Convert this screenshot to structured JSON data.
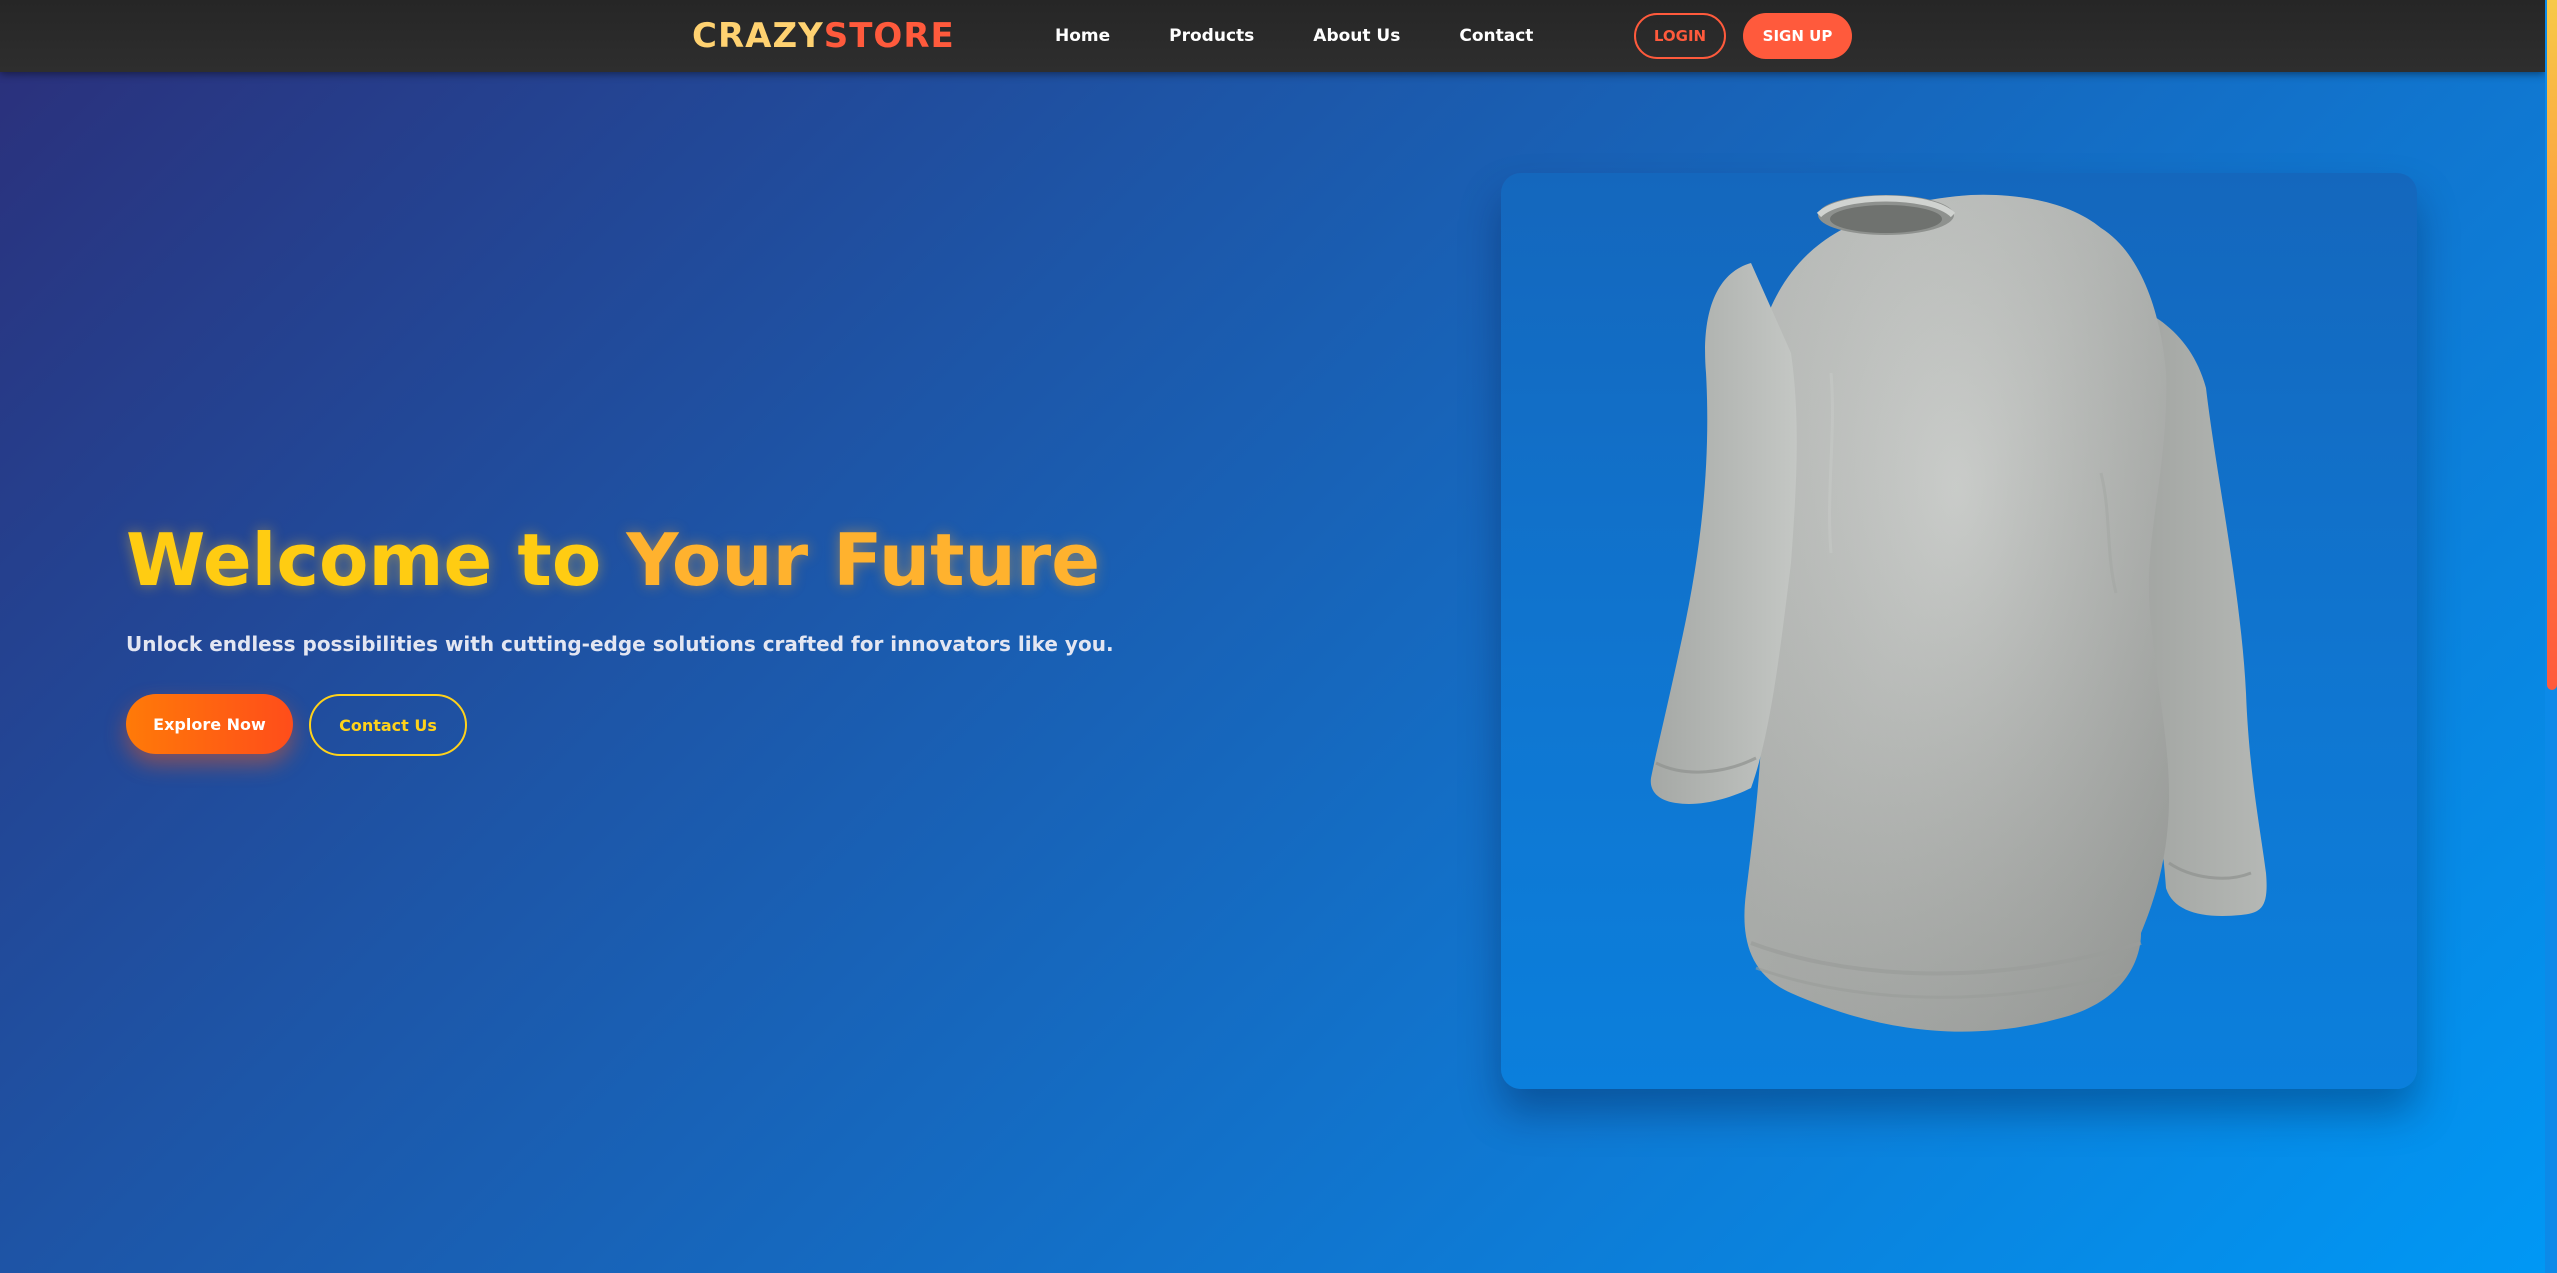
{
  "nav": {
    "logo_part1": "CRAZY",
    "logo_part2": "STORE",
    "links": [
      "Home",
      "Products",
      "About Us",
      "Contact"
    ],
    "login_label": "LOGIN",
    "signup_label": "SIGN UP"
  },
  "hero": {
    "title_part1": "Welcome to",
    "title_part2": "Your Future",
    "subtitle": "Unlock endless possibilities with cutting-edge solutions crafted for innovators like you.",
    "explore_label": "Explore Now",
    "contact_label": "Contact Us"
  },
  "product": {
    "image_subject": "grey long-sleeve shirt",
    "icon": "shirt-image"
  },
  "colors": {
    "accent_orange": "#ff5a3c",
    "accent_yellow": "#ffcc12",
    "logo_yellow": "#ffd271",
    "navbar_bg": "#262626",
    "hero_gradient_start": "#2b2f7a",
    "hero_gradient_end": "#0098f5"
  }
}
